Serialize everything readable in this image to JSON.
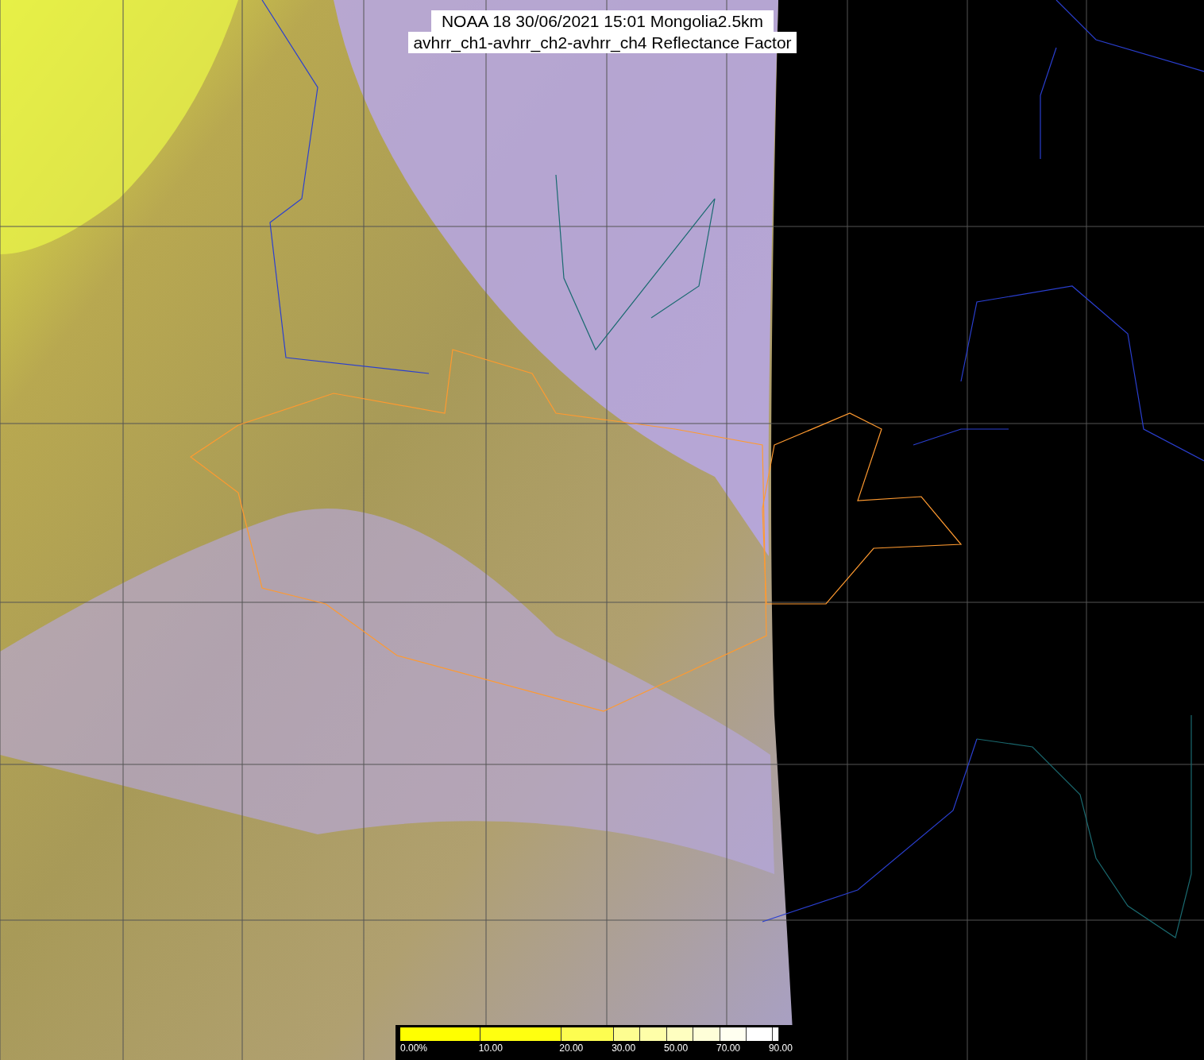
{
  "title": {
    "lines": [
      "NOAA 18 30/06/2021 15:01 Mongolia2.5km",
      "avhrr_ch1-avhrr_ch2-avhrr_ch4 Reflectance Factor"
    ]
  },
  "colorbar": {
    "labels": [
      "0.00%",
      "10.00",
      "20.00",
      "30.00",
      "50.00",
      "70.00",
      "90.00"
    ]
  }
}
